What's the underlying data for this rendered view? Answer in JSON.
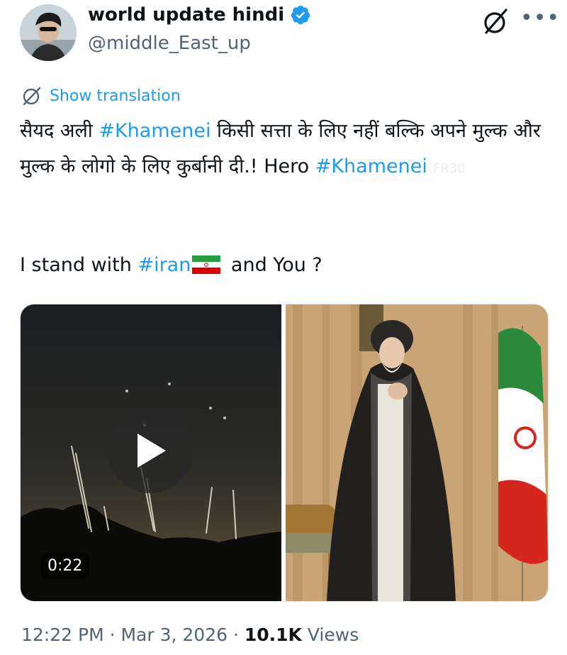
{
  "author": {
    "name": "world update hindi",
    "handle": "@middle_East_up"
  },
  "translation": {
    "label": "Show translation"
  },
  "tweet": {
    "line1_a": "सैयद अली ",
    "line1_tag": "#Khamenei",
    "line1_b": " किसी सत्ता के लिए नहीं बल्कि अपने मुल्क और मुल्क के लोगो के लिए कुर्बानी दी.! Hero ",
    "line1_tag2": "#Khamenei",
    "ghost_text": "FR30",
    "line2_a": "I stand with ",
    "line2_tag": "#iran",
    "line2_b": " and You ?"
  },
  "media": {
    "video_duration": "0:22"
  },
  "meta": {
    "time": "12:22 PM · Mar 3, 2026 · ",
    "views_count": "10.1K",
    "views_label": " Views"
  },
  "icons": [
    "verified-badge-icon",
    "grok-icon",
    "more-icon",
    "translate-icon",
    "play-icon",
    "iran-flag-icon"
  ],
  "colors": {
    "link": "#1d9bf0",
    "secondary": "#536471",
    "text": "#0f1419"
  }
}
